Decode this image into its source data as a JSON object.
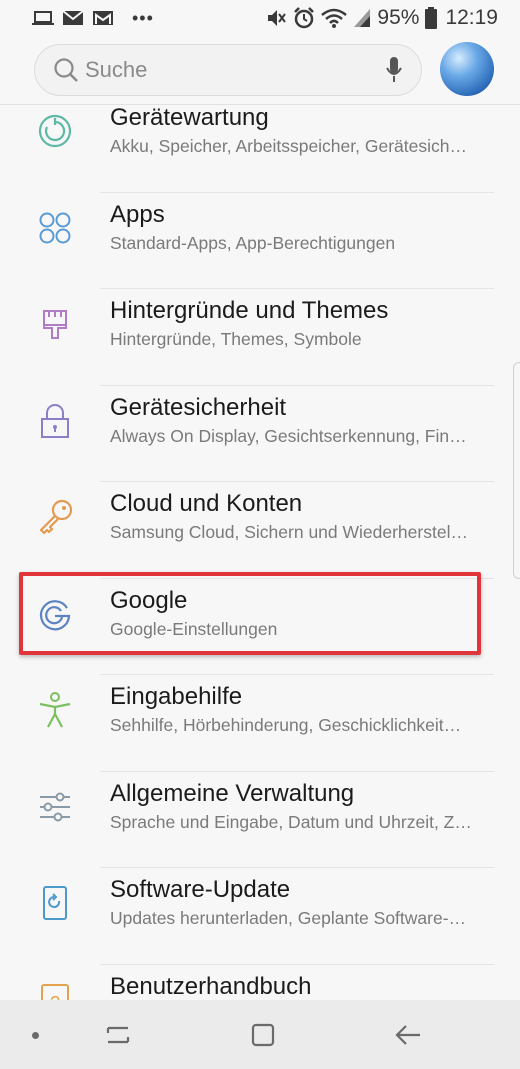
{
  "status": {
    "battery": "95%",
    "time": "12:19",
    "left_icons": [
      "laptop-icon",
      "mail-icon",
      "gmail-icon",
      "more-icon"
    ],
    "right_icons": [
      "mute-icon",
      "alarm-icon",
      "wifi-icon",
      "signal-icon",
      "battery-icon"
    ]
  },
  "search": {
    "placeholder": "Suche"
  },
  "items": [
    {
      "title": "Gerätewartung",
      "subtitle": "Akku, Speicher, Arbeitsspeicher, Gerätesich…",
      "icon": "device-care-icon",
      "color": "#5fb8a6"
    },
    {
      "title": "Apps",
      "subtitle": "Standard-Apps, App-Berechtigungen",
      "icon": "apps-icon",
      "color": "#5b9bd5"
    },
    {
      "title": "Hintergründe und Themes",
      "subtitle": "Hintergründe, Themes, Symbole",
      "icon": "brush-icon",
      "color": "#b07cc6"
    },
    {
      "title": "Gerätesicherheit",
      "subtitle": "Always On Display, Gesichtserkennung, Fin…",
      "icon": "lock-icon",
      "color": "#8b7fc9"
    },
    {
      "title": "Cloud und Konten",
      "subtitle": "Samsung Cloud, Sichern und Wiederherstel…",
      "icon": "key-icon",
      "color": "#e39a52"
    },
    {
      "title": "Google",
      "subtitle": "Google-Einstellungen",
      "icon": "google-icon",
      "color": "#5d84c2"
    },
    {
      "title": "Eingabehilfe",
      "subtitle": "Sehhilfe, Hörbehinderung, Geschicklichkeit…",
      "icon": "accessibility-icon",
      "color": "#7bbf5e"
    },
    {
      "title": "Allgemeine Verwaltung",
      "subtitle": "Sprache und Eingabe, Datum und Uhrzeit, Z…",
      "icon": "sliders-icon",
      "color": "#8a9aa6"
    },
    {
      "title": "Software-Update",
      "subtitle": "Updates herunterladen, Geplante Software-…",
      "icon": "software-update-icon",
      "color": "#4c9ac9"
    },
    {
      "title": "Benutzerhandbuch",
      "subtitle": "",
      "icon": "manual-icon",
      "color": "#e3a24f"
    }
  ],
  "highlight_color": "#e0353a",
  "nav": {
    "icons": [
      "dot-icon",
      "recents-icon",
      "home-icon",
      "back-icon"
    ]
  }
}
